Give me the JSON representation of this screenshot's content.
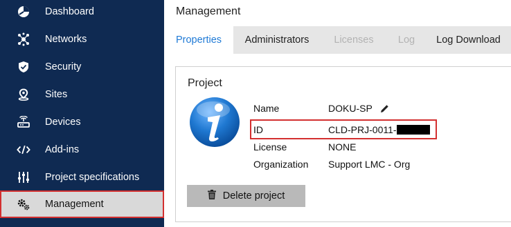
{
  "sidebar": {
    "items": [
      {
        "label": "Dashboard",
        "icon": "dashboard-icon"
      },
      {
        "label": "Networks",
        "icon": "networks-icon"
      },
      {
        "label": "Security",
        "icon": "shield-icon"
      },
      {
        "label": "Sites",
        "icon": "location-pin-icon"
      },
      {
        "label": "Devices",
        "icon": "router-icon"
      },
      {
        "label": "Add-ins",
        "icon": "code-icon"
      },
      {
        "label": "Project specifications",
        "icon": "sliders-icon"
      },
      {
        "label": "Management",
        "icon": "gears-icon",
        "active": true
      }
    ]
  },
  "header": {
    "title": "Management"
  },
  "tabs": [
    {
      "label": "Properties",
      "state": "active"
    },
    {
      "label": "Administrators",
      "state": "normal"
    },
    {
      "label": "Licenses",
      "state": "disabled"
    },
    {
      "label": "Log",
      "state": "disabled"
    },
    {
      "label": "Log Download",
      "state": "normal"
    }
  ],
  "project": {
    "title": "Project",
    "icon": "info-icon",
    "name_label": "Name",
    "name_value": "DOKU-SP",
    "id_label": "ID",
    "id_value": "CLD-PRJ-0011-",
    "license_label": "License",
    "license_value": "NONE",
    "org_label": "Organization",
    "org_value": "Support LMC - Org",
    "delete_label": "Delete project"
  },
  "colors": {
    "sidebar_bg": "#0f2a52",
    "active_tab_text": "#1f7ad6",
    "highlight_border": "#d32f2f"
  }
}
